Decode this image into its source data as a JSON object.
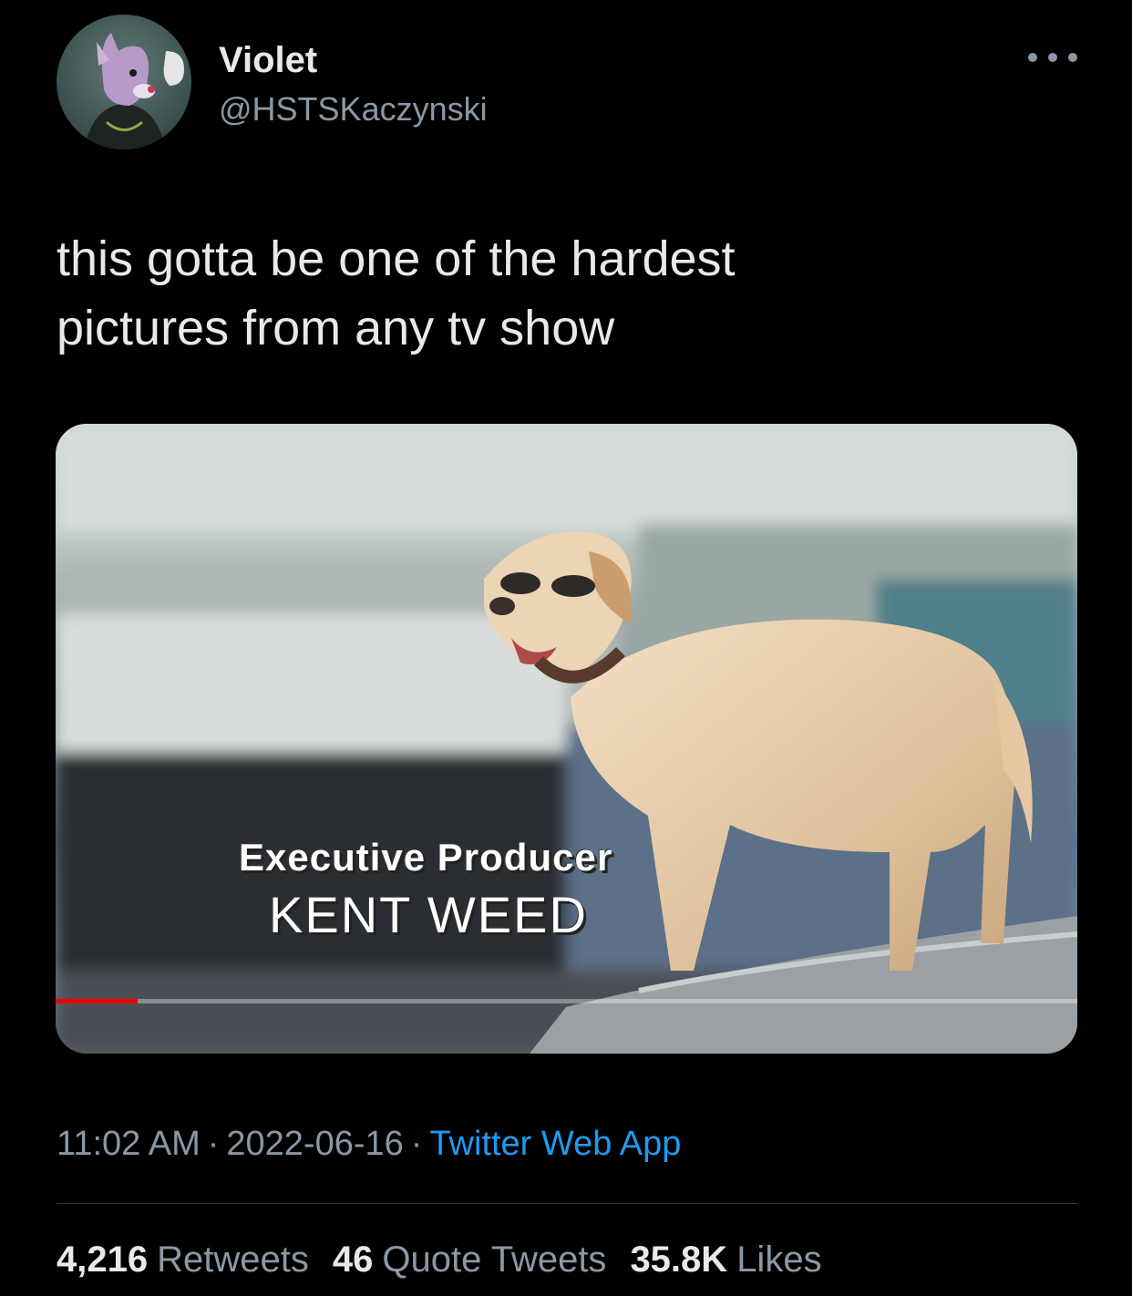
{
  "author": {
    "name": "Violet",
    "handle": "@HSTSKaczynski"
  },
  "tweet": {
    "text": "this gotta be one of the hardest\npictures from any tv show"
  },
  "media": {
    "caption_role": "Executive Producer",
    "caption_name": "KENT WEED",
    "progress_fraction": 0.08
  },
  "meta": {
    "time": "11:02 AM",
    "date": "2022-06-16",
    "source": "Twitter Web App",
    "separator": "·"
  },
  "stats": {
    "retweets_count": "4,216",
    "retweets_label": "Retweets",
    "quotes_count": "46",
    "quotes_label": "Quote Tweets",
    "likes_count": "35.8K",
    "likes_label": "Likes"
  },
  "colors": {
    "background": "#000000",
    "text": "#e7e9ea",
    "muted": "#8b98a5",
    "link": "#1d9bf0",
    "progress": "#ee0000"
  }
}
